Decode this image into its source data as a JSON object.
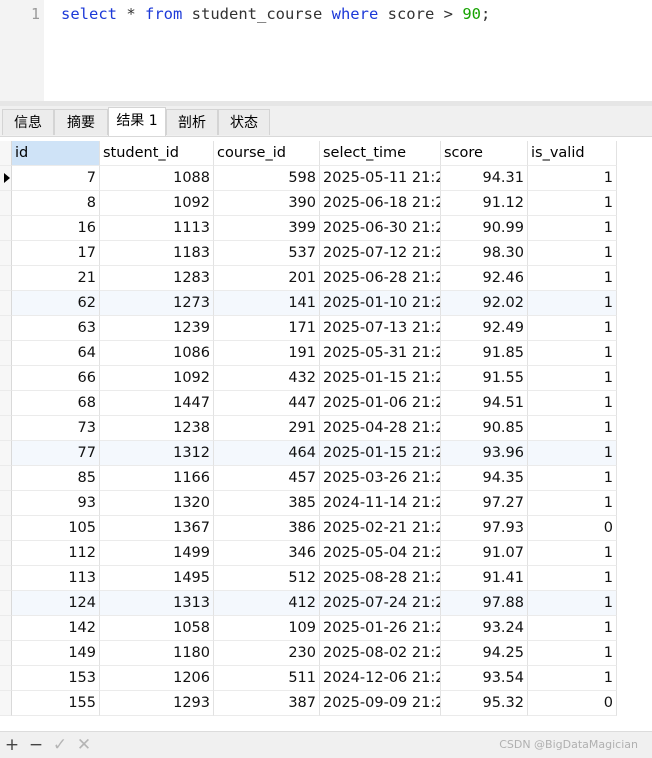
{
  "editor": {
    "line_number": "1",
    "sql": {
      "kw_select": "select",
      "star": " * ",
      "kw_from": "from",
      "table": " student_course ",
      "kw_where": "where",
      "cond": " score > ",
      "value": "90",
      "end": ";"
    }
  },
  "tabs": [
    {
      "label": "信息"
    },
    {
      "label": "摘要"
    },
    {
      "label": "结果 1"
    },
    {
      "label": "剖析"
    },
    {
      "label": "状态"
    }
  ],
  "grid": {
    "columns": [
      "id",
      "student_id",
      "course_id",
      "select_time",
      "score",
      "is_valid"
    ],
    "rows": [
      [
        "7",
        "1088",
        "598",
        "2025-05-11 21:2",
        "94.31",
        "1"
      ],
      [
        "8",
        "1092",
        "390",
        "2025-06-18 21:2",
        "91.12",
        "1"
      ],
      [
        "16",
        "1113",
        "399",
        "2025-06-30 21:2",
        "90.99",
        "1"
      ],
      [
        "17",
        "1183",
        "537",
        "2025-07-12 21:2",
        "98.30",
        "1"
      ],
      [
        "21",
        "1283",
        "201",
        "2025-06-28 21:2",
        "92.46",
        "1"
      ],
      [
        "62",
        "1273",
        "141",
        "2025-01-10 21:2",
        "92.02",
        "1"
      ],
      [
        "63",
        "1239",
        "171",
        "2025-07-13 21:2",
        "92.49",
        "1"
      ],
      [
        "64",
        "1086",
        "191",
        "2025-05-31 21:2",
        "91.85",
        "1"
      ],
      [
        "66",
        "1092",
        "432",
        "2025-01-15 21:2",
        "91.55",
        "1"
      ],
      [
        "68",
        "1447",
        "447",
        "2025-01-06 21:2",
        "94.51",
        "1"
      ],
      [
        "73",
        "1238",
        "291",
        "2025-04-28 21:2",
        "90.85",
        "1"
      ],
      [
        "77",
        "1312",
        "464",
        "2025-01-15 21:2",
        "93.96",
        "1"
      ],
      [
        "85",
        "1166",
        "457",
        "2025-03-26 21:2",
        "94.35",
        "1"
      ],
      [
        "93",
        "1320",
        "385",
        "2024-11-14 21:2",
        "97.27",
        "1"
      ],
      [
        "105",
        "1367",
        "386",
        "2025-02-21 21:2",
        "97.93",
        "0"
      ],
      [
        "112",
        "1499",
        "346",
        "2025-05-04 21:2",
        "91.07",
        "1"
      ],
      [
        "113",
        "1495",
        "512",
        "2025-08-28 21:2",
        "91.41",
        "1"
      ],
      [
        "124",
        "1313",
        "412",
        "2025-07-24 21:2",
        "97.88",
        "1"
      ],
      [
        "142",
        "1058",
        "109",
        "2025-01-26 21:2",
        "93.24",
        "1"
      ],
      [
        "149",
        "1180",
        "230",
        "2025-08-02 21:2",
        "94.25",
        "1"
      ],
      [
        "153",
        "1206",
        "511",
        "2024-12-06 21:2",
        "93.54",
        "1"
      ],
      [
        "155",
        "1293",
        "387",
        "2025-09-09 21:2",
        "95.32",
        "0"
      ]
    ]
  },
  "toolbar": {
    "add": "+",
    "remove": "−",
    "apply": "✓",
    "cancel": "✕"
  },
  "watermark": "CSDN @BigDataMagician"
}
